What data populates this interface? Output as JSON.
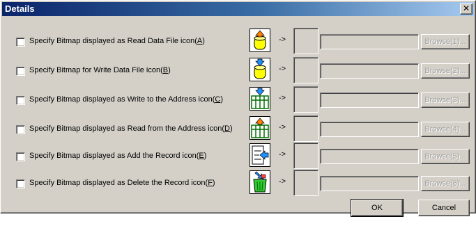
{
  "window": {
    "title": "Details",
    "close_glyph": "✕"
  },
  "rows": [
    {
      "pre": "Specify Bitmap displayed as Read Data File icon(",
      "accel": "A",
      "post": ")",
      "icon": "read-data-file-icon",
      "browse": "Browse(1)..."
    },
    {
      "pre": "Specify Bitmap for Write Data File icon(",
      "accel": "B",
      "post": ")",
      "icon": "write-data-file-icon",
      "browse": "Browse(2)..."
    },
    {
      "pre": "Specify Bitmap displayed as Write to the Address icon(",
      "accel": "C",
      "post": ")",
      "icon": "write-address-icon",
      "browse": "Browse(3)..."
    },
    {
      "pre": "Specify Bitmap displayed as Read from the Address icon(",
      "accel": "D",
      "post": ")",
      "icon": "read-address-icon",
      "browse": "Browse(4)..."
    },
    {
      "pre": "Specify Bitmap displayed as Add the Record icon(",
      "accel": "E",
      "post": ")",
      "icon": "add-record-icon",
      "browse": "Browse(5)..."
    },
    {
      "pre": "Specify Bitmap displayed as Delete the Record icon(",
      "accel": "F",
      "post": ")",
      "icon": "delete-record-icon",
      "browse": "Browse(6)..."
    }
  ],
  "arrow": "->",
  "buttons": {
    "ok": "OK",
    "cancel": "Cancel"
  }
}
